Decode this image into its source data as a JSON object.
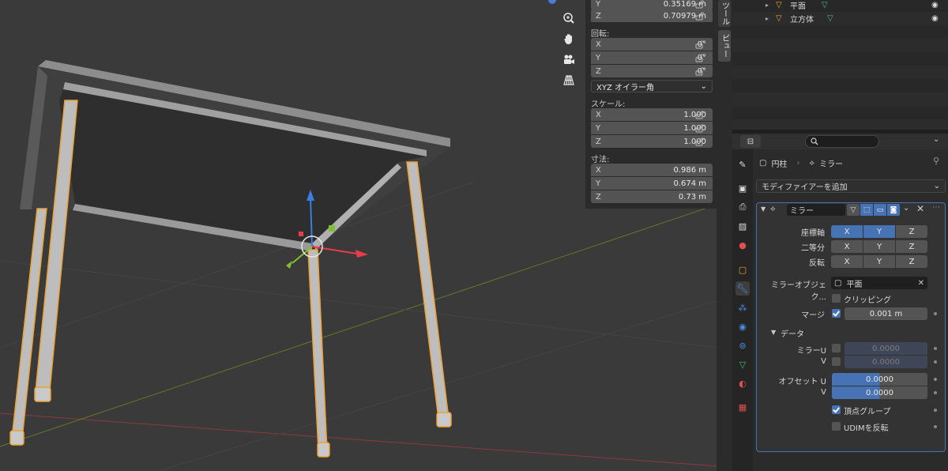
{
  "npanel": {
    "location": {
      "y_axis": "Y",
      "y": "0.35169 m",
      "z_axis": "Z",
      "z": "0.70979 m"
    },
    "rotation": {
      "label": "回転:",
      "rows": [
        {
          "axis": "X",
          "value": "0°"
        },
        {
          "axis": "Y",
          "value": "0°"
        },
        {
          "axis": "Z",
          "value": "0°"
        }
      ],
      "mode": "XYZ オイラー角"
    },
    "scale": {
      "label": "スケール:",
      "rows": [
        {
          "axis": "X",
          "value": "1.000"
        },
        {
          "axis": "Y",
          "value": "1.000"
        },
        {
          "axis": "Z",
          "value": "1.000"
        }
      ]
    },
    "dimensions": {
      "label": "寸法:",
      "rows": [
        {
          "axis": "X",
          "value": "0.986 m"
        },
        {
          "axis": "Y",
          "value": "0.674 m"
        },
        {
          "axis": "Z",
          "value": "0.73 m"
        }
      ]
    }
  },
  "vtabs": {
    "tool": "ツール",
    "view": "ビュー"
  },
  "outliner": {
    "items": [
      {
        "name": "平面"
      },
      {
        "name": "立方体"
      }
    ]
  },
  "props": {
    "search_placeholder": "",
    "breadcrumb": {
      "object": "円柱",
      "modifier": "ミラー"
    },
    "add_modifier": "モディファイアーを追加",
    "modifier": {
      "name": "ミラー",
      "axis_label": "座標軸",
      "bisect_label": "二等分",
      "flip_label": "反転",
      "x": "X",
      "y": "Y",
      "z": "Z",
      "mirror_object_label": "ミラーオブジェク...",
      "mirror_object_value": "平面",
      "clipping_label": "クリッピング",
      "merge_label": "マージ",
      "merge_value": "0.001 m",
      "data_label": "データ",
      "mirror_u_label": "ミラーU",
      "mirror_u_value": "0.0000",
      "v_label": "V",
      "mirror_v_value": "0.0000",
      "offset_u_label": "オフセット U",
      "offset_u_value": "0.0000",
      "offset_v_label": "V",
      "offset_v_value": "0.0000",
      "vertex_groups_label": "頂点グループ",
      "flip_udim_label": "UDIMを反転"
    }
  },
  "colors": {
    "accent": "#4772b3",
    "selection_outline": "#f0a030",
    "x_axis": "#e83c48",
    "y_axis": "#7fbf30",
    "z_axis": "#3a7ee0"
  }
}
